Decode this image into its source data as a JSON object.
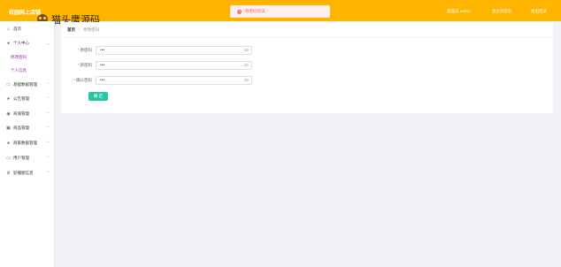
{
  "header": {
    "app_title": "校园网上店铺",
    "links": [
      "管理员 admin",
      "退出到前台",
      "退出登录"
    ]
  },
  "watermark": {
    "text": "猫头鹰源码"
  },
  "toast": {
    "message": "原密码错误",
    "icon": "error-circle-icon",
    "color": "#f56c6c"
  },
  "sidebar": {
    "items": [
      {
        "label": "首页",
        "icon": "home-icon"
      },
      {
        "label": "个人中心",
        "icon": "user-icon",
        "expanded": true,
        "children": [
          {
            "label": "修改密码"
          },
          {
            "label": "个人信息"
          }
        ]
      },
      {
        "label": "基础数据管理",
        "icon": "folder-icon"
      },
      {
        "label": "公告管理",
        "icon": "send-icon"
      },
      {
        "label": "商城管理",
        "icon": "location-icon"
      },
      {
        "label": "商品管理",
        "icon": "box-icon"
      },
      {
        "label": "商家数据管理",
        "icon": "user-icon"
      },
      {
        "label": "用户管理",
        "icon": "folder-icon"
      },
      {
        "label": "轮播图信息",
        "icon": "settings-icon"
      }
    ]
  },
  "breadcrumb": {
    "home": "首页",
    "separator": "/",
    "current": "修改密码"
  },
  "form": {
    "fields": [
      {
        "label": "原密码",
        "value": "•••"
      },
      {
        "label": "新密码",
        "value": "•••"
      },
      {
        "label": "确认密码",
        "value": "•••"
      }
    ],
    "required_mark": "*",
    "submit_label": "确 定"
  },
  "colors": {
    "header": "#ffb400",
    "accent": "#26c6a4",
    "submenu": "#9c27b0"
  }
}
